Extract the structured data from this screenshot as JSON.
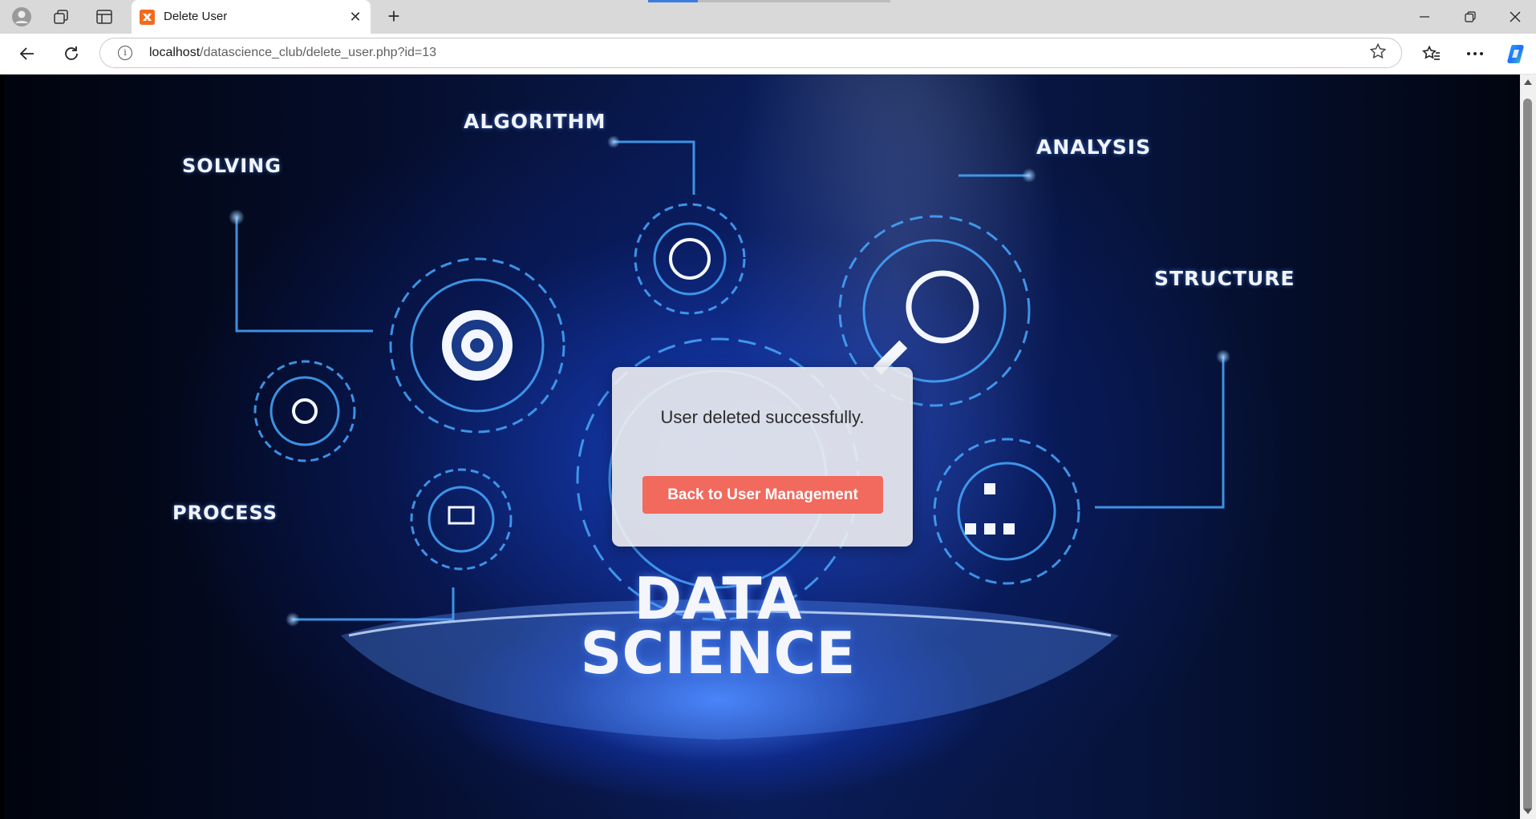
{
  "browser": {
    "tab_title": "Delete User",
    "favicon_text": "⦿",
    "url_host": "localhost",
    "url_path": "/datascience_club/delete_user.php?id=13"
  },
  "background": {
    "labels": {
      "solving": "SOLVING",
      "algorithm": "ALGORITHM",
      "analysis": "ANALYSIS",
      "structure": "STRUCTURE",
      "process": "PROCESS",
      "data": "DATA",
      "science": "SCIENCE"
    }
  },
  "card": {
    "message": "User deleted successfully.",
    "button_label": "Back to User Management",
    "button_color": "#f2695d"
  },
  "icons": [
    "profile-icon",
    "workspaces-icon",
    "tab-actions-icon",
    "close-icon",
    "new-tab-icon",
    "minimize-icon",
    "restore-icon",
    "window-close-icon",
    "back-icon",
    "refresh-icon",
    "site-info-icon",
    "favorite-star-icon",
    "favorites-icon",
    "more-icon",
    "copilot-icon"
  ]
}
